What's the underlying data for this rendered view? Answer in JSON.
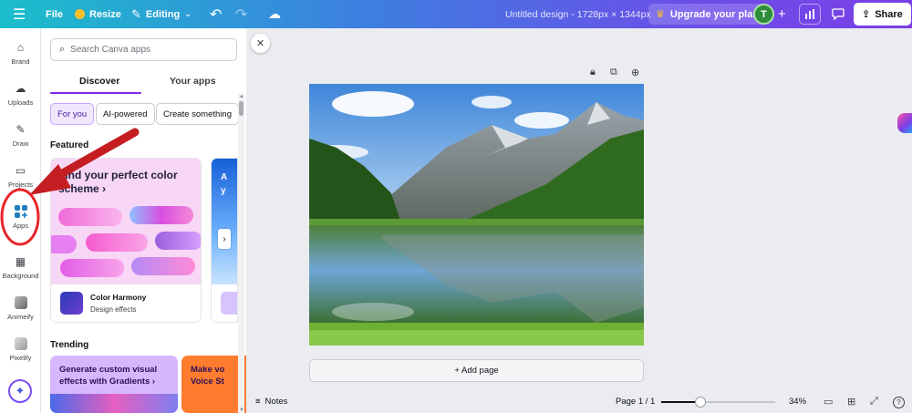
{
  "topbar": {
    "file": "File",
    "resize": "Resize",
    "editing": "Editing",
    "doc_title": "Untitled design - 1728px × 1344px",
    "upgrade": "Upgrade your plan",
    "avatar_initial": "T",
    "share": "Share"
  },
  "rail": {
    "items": [
      {
        "label": "Brand",
        "icon": "brand-icon"
      },
      {
        "label": "Uploads",
        "icon": "uploads-icon"
      },
      {
        "label": "Draw",
        "icon": "draw-icon"
      },
      {
        "label": "Projects",
        "icon": "projects-icon"
      },
      {
        "label": "Apps",
        "icon": "apps-icon"
      },
      {
        "label": "Background",
        "icon": "background-icon"
      },
      {
        "label": "Animeify",
        "icon": "animeify-icon"
      },
      {
        "label": "Pixelify",
        "icon": "pixelify-icon"
      }
    ]
  },
  "panel": {
    "search_placeholder": "Search Canva apps",
    "tabs": [
      "Discover",
      "Your apps"
    ],
    "chips": [
      "For you",
      "AI-powered",
      "Create something"
    ],
    "featured_heading": "Featured",
    "featured_card": {
      "title": "Find your perfect color scheme ›",
      "app_name": "Color Harmony",
      "app_sub": "Design effects"
    },
    "second_card_title": "A\ny",
    "trending_heading": "Trending",
    "trending": [
      {
        "title": "Generate custom visual effects with Gradients ›"
      },
      {
        "title": "Make vo\nVoice St"
      }
    ]
  },
  "canvas": {
    "add_page": "+ Add page"
  },
  "bottombar": {
    "notes": "Notes",
    "page_indicator": "Page 1 / 1",
    "zoom": "34%",
    "zoom_fraction": 0.34
  },
  "colors": {
    "accent": "#7d2ae8",
    "annotation_red": "#e8262a"
  }
}
